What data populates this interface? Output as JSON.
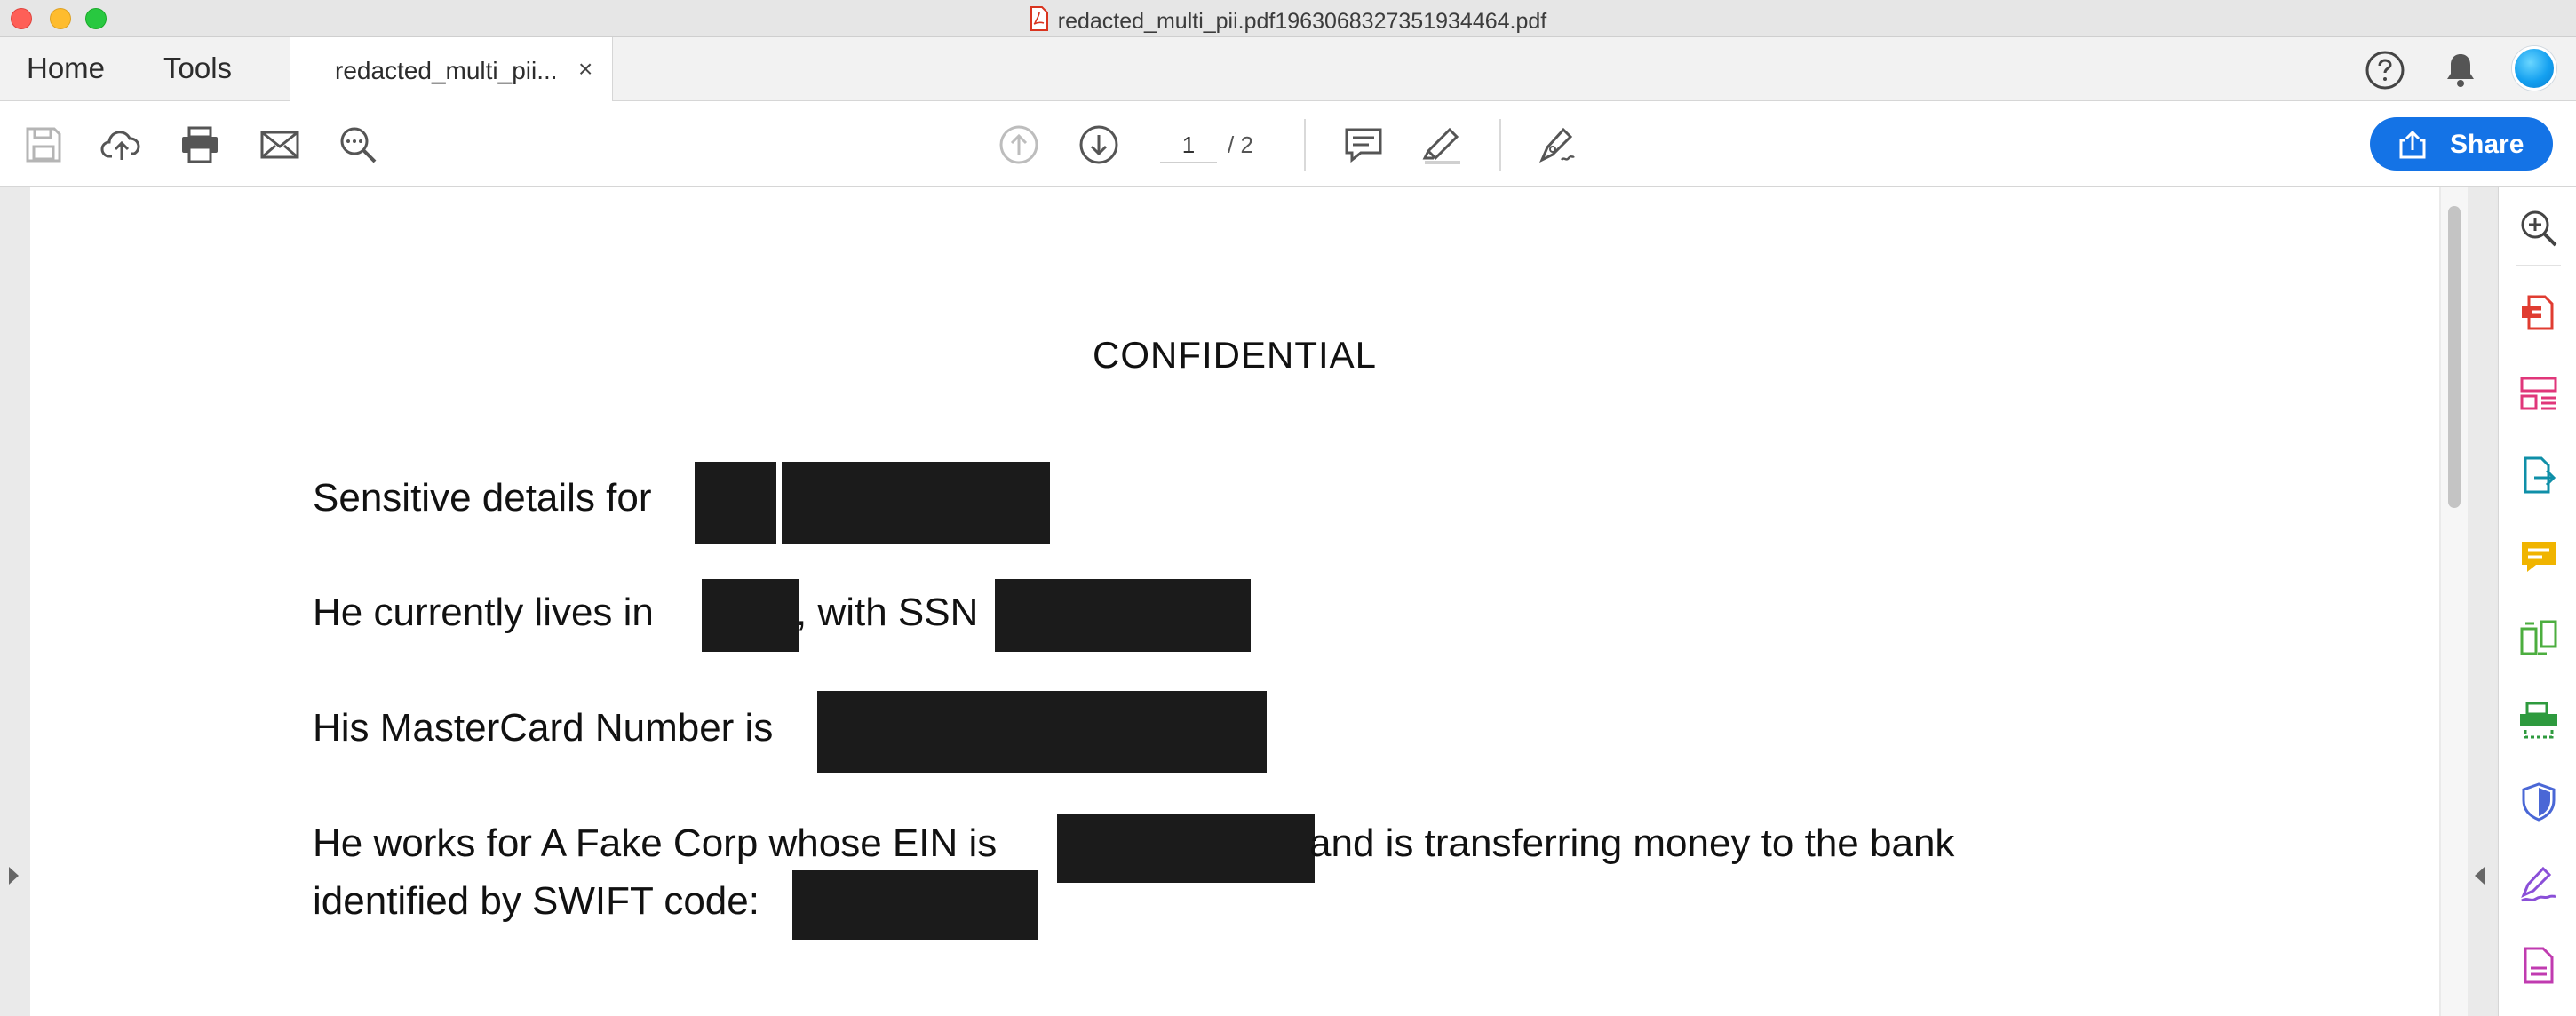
{
  "window": {
    "title": "redacted_multi_pii.pdf1963068327351934464.pdf"
  },
  "tabbar": {
    "home_label": "Home",
    "tools_label": "Tools",
    "doc_tab_label": "redacted_multi_pii...",
    "close_glyph": "×"
  },
  "toolbar": {
    "icons": [
      "save-icon",
      "upload-cloud-icon",
      "print-icon",
      "email-icon",
      "zoom-search-icon",
      "page-up-icon",
      "page-down-icon",
      "comment-icon",
      "highlight-icon",
      "sign-icon"
    ],
    "current_page": "1",
    "total_pages": "/ 2",
    "share_label": "Share"
  },
  "document": {
    "heading": "CONFIDENTIAL",
    "line1": "Sensitive details for",
    "line2_a": "He currently lives in",
    "line2_b": ", with SSN",
    "line3": "His MasterCard Number is",
    "line4_a": "He works for A Fake Corp whose EIN is",
    "line4_b": "and is transferring money to the bank",
    "line5": "identified by SWIFT code:"
  },
  "right_rail": {
    "icons": [
      "zoom-in-icon",
      "export-pdf-icon",
      "organize-pages-icon",
      "share-file-icon",
      "comment-tool-icon",
      "compare-icon",
      "scan-icon",
      "protect-icon",
      "fill-sign-icon",
      "more-tools-icon"
    ]
  },
  "colors": {
    "accent": "#1473e6",
    "redaction": "#1b1b1b"
  }
}
